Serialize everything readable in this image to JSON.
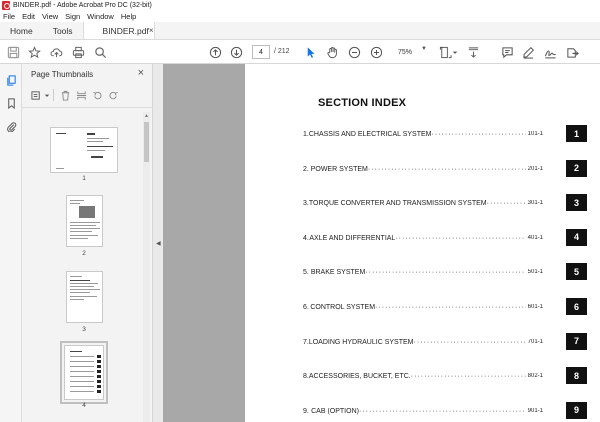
{
  "window": {
    "title": "BINDER.pdf - Adobe Acrobat Pro DC (32-bit)"
  },
  "menu": [
    "File",
    "Edit",
    "View",
    "Sign",
    "Window",
    "Help"
  ],
  "tabs": {
    "home": "Home",
    "tools": "Tools",
    "document": "BINDER.pdf",
    "close": "×"
  },
  "toolbar": {
    "page_current": "4",
    "page_total": "/ 212",
    "zoom": "75%"
  },
  "thumbnail_panel": {
    "title": "Page Thumbnails",
    "close": "×",
    "thumbnails": [
      {
        "label": "1"
      },
      {
        "label": "2"
      },
      {
        "label": "3"
      },
      {
        "label": "4",
        "selected": true
      }
    ]
  },
  "document": {
    "heading": "SECTION INDEX",
    "entries": [
      {
        "num": "1.",
        "title": "CHASSIS AND ELECTRICAL SYSTEM",
        "ref": "101-1",
        "box": "1"
      },
      {
        "num": "2.",
        "title": "POWER SYSTEM",
        "ref": "201-1",
        "box": "2"
      },
      {
        "num": "3.",
        "title": "TORQUE CONVERTER AND TRANSMISSION SYSTEM",
        "ref": "301-1",
        "box": "3"
      },
      {
        "num": "4.",
        "title": "AXLE AND DIFFERENTIAL",
        "ref": "401-1",
        "box": "4"
      },
      {
        "num": "5.",
        "title": "BRAKE SYSTEM",
        "ref": "501-1",
        "box": "5"
      },
      {
        "num": "6.",
        "title": "CONTROL SYSTEM",
        "ref": "601-1",
        "box": "6"
      },
      {
        "num": "7.",
        "title": "LOADING HYDRAULIC SYSTEM",
        "ref": "701-1",
        "box": "7"
      },
      {
        "num": "8.",
        "title": "ACCESSORIES, BUCKET, ETC.",
        "ref": "802-1",
        "box": "8"
      },
      {
        "num": "9.",
        "title": "CAB (OPTION)",
        "ref": "901-1",
        "box": "9"
      }
    ]
  },
  "colors": {
    "accent": "#1473e6",
    "app_icon": "#d7282f",
    "doc_bg": "#a8a8a8"
  }
}
